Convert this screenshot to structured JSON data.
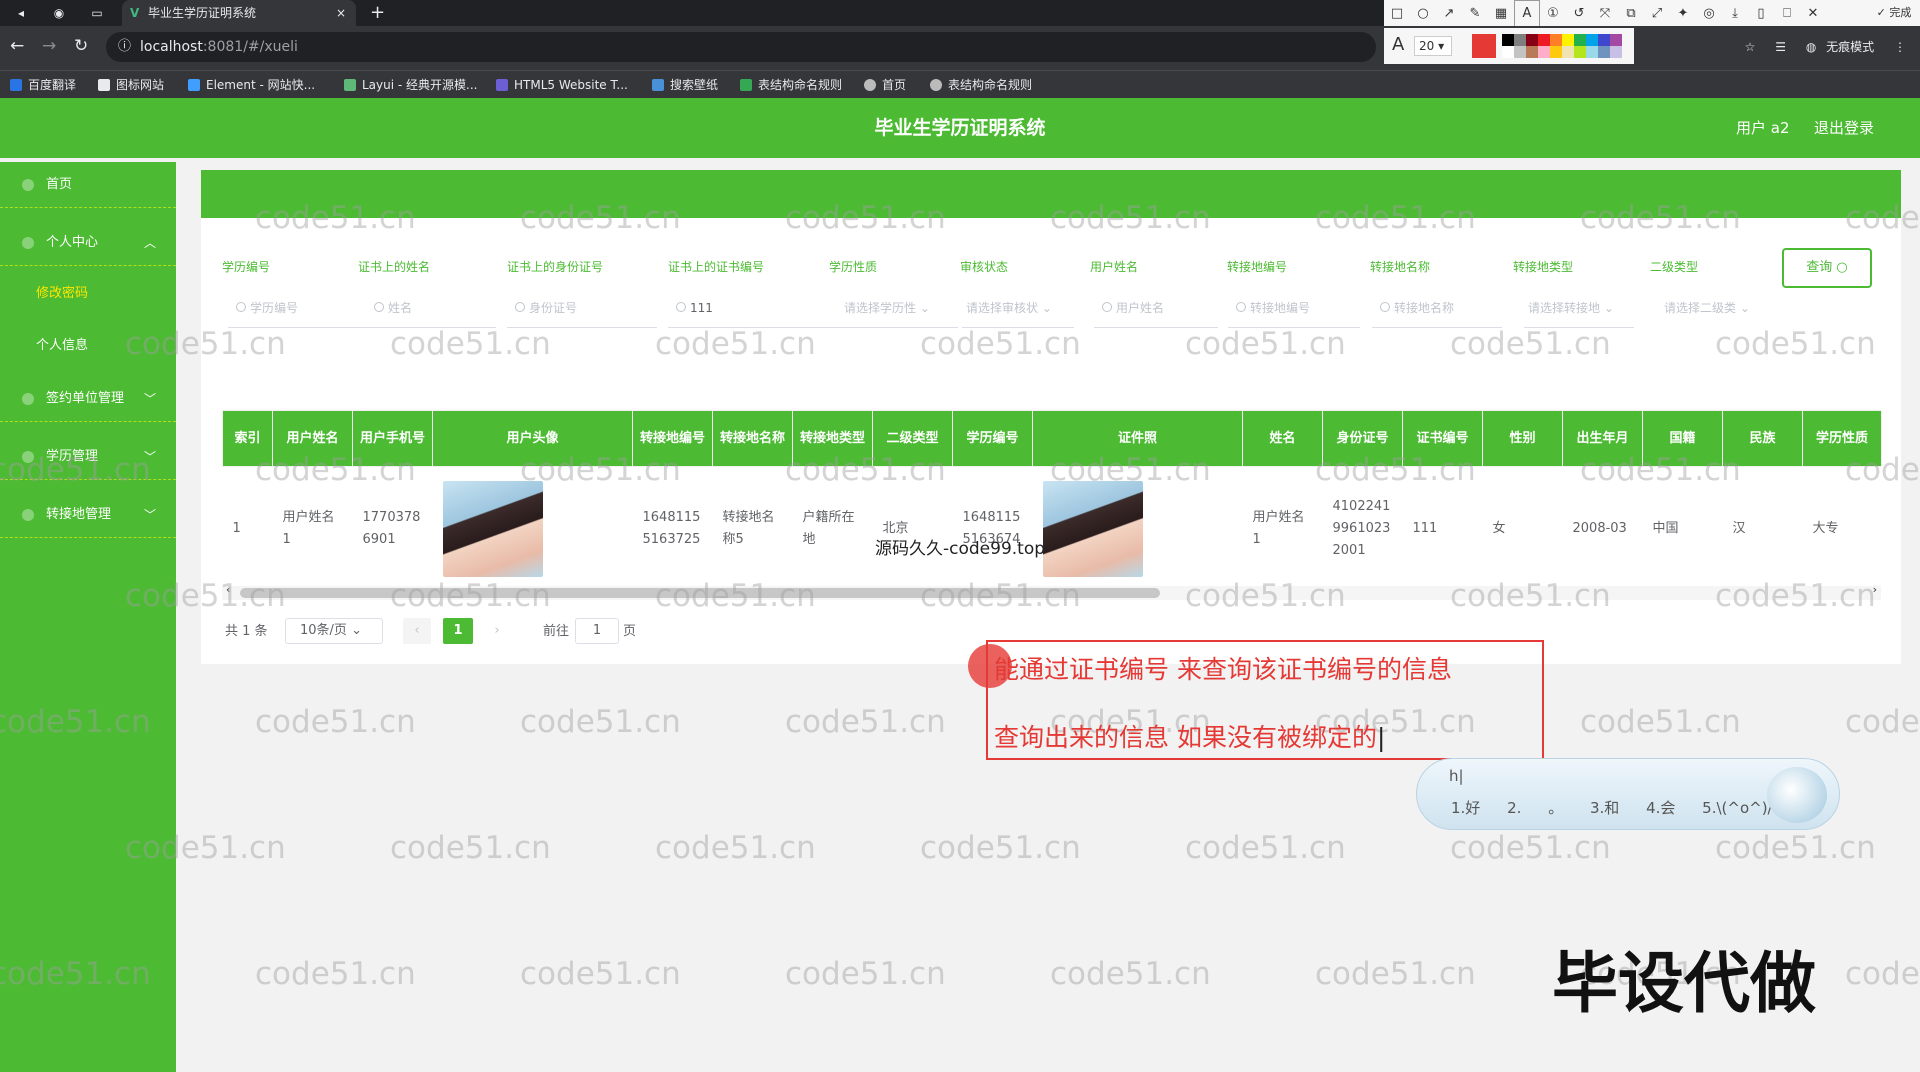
{
  "browser": {
    "tab_title": "毕业生学历证明系统",
    "tab_icon": "V",
    "close_glyph": "×",
    "new_tab_glyph": "+",
    "url_host": "localhost",
    "url_path": ":8081/#/xueli",
    "incognito_label": "无痕模式",
    "bookmarks": [
      "百度翻译",
      "图标网站",
      "Element - 网站快...",
      "Layui - 经典开源模...",
      "HTML5 Website T...",
      "搜索壁纸",
      "表结构命名规则",
      "首页",
      "表结构命名规则"
    ]
  },
  "annot_tool": {
    "font_glyph": "A",
    "font_size": "20",
    "current_color": "#e53935",
    "palette": [
      "#000000",
      "#7f7f7f",
      "#880015",
      "#ed1c24",
      "#ff7f27",
      "#fff200",
      "#22b14c",
      "#00a2e8",
      "#3f48cc",
      "#a349a4",
      "#ffffff",
      "#c3c3c3",
      "#b97a57",
      "#ffaec9",
      "#ffc90e",
      "#efe4b0",
      "#b5e61d",
      "#99d9ea",
      "#7092be",
      "#c8bfe7"
    ],
    "done_label": "✓ 完成"
  },
  "header": {
    "title": "毕业生学历证明系统",
    "user": "用户 a2",
    "logout": "退出登录"
  },
  "sidebar": {
    "home": "首页",
    "personal": "个人中心",
    "change_pwd": "修改密码",
    "profile": "个人信息",
    "signing": "签约单位管理",
    "education": "学历管理",
    "transfer": "转接地管理"
  },
  "search": {
    "labels": [
      "学历编号",
      "证书上的姓名",
      "证书上的身份证号",
      "证书上的证书编号",
      "学历性质",
      "审核状态",
      "用户姓名",
      "转接地编号",
      "转接地名称",
      "转接地类型",
      "二级类型"
    ],
    "placeholders": [
      "学历编号",
      "姓名",
      "身份证号",
      "111",
      "请选择学历性",
      "请选择审核状",
      "用户姓名",
      "转接地编号",
      "转接地名称",
      "请选择转接地",
      "请选择二级类"
    ],
    "button": "查询"
  },
  "table": {
    "headers": [
      "索引",
      "用户姓名",
      "用户手机号",
      "用户头像",
      "转接地编号",
      "转接地名称",
      "转接地类型",
      "二级类型",
      "学历编号",
      "证件照",
      "姓名",
      "身份证号",
      "证书编号",
      "性别",
      "出生年月",
      "国籍",
      "民族",
      "学历性质"
    ],
    "row": {
      "index": "1",
      "user_name": "用户姓名1",
      "phone": "17703786901",
      "transfer_no": "16481155163725",
      "transfer_name": "转接地名称5",
      "transfer_type": "户籍所在地",
      "second_type": "北京",
      "edu_no": "16481155163674",
      "name": "用户姓名1",
      "id_no": "410224199610232001",
      "cert_no": "111",
      "gender": "女",
      "birth": "2008-03",
      "nation": "中国",
      "ethnic": "汉",
      "edu_type": "大专"
    }
  },
  "pager": {
    "total": "共 1 条",
    "size": "10条/页",
    "prev": "‹",
    "current": "1",
    "next": "›",
    "goto": "前往",
    "page_value": "1",
    "page_unit": "页"
  },
  "overlay": {
    "source_text": "源码久久-code99.top",
    "annotation_line1": "能通过证书编号 来查询该证书编号的信息",
    "annotation_line2": "查询出来的信息 如果没有被绑定的",
    "ime_input": "h",
    "ime_candidates": [
      "1.好",
      "2.",
      "。",
      "3.和",
      "4.会",
      "5.\\(^o^)/"
    ],
    "brand": "毕设代做",
    "watermark": "code51.cn"
  }
}
